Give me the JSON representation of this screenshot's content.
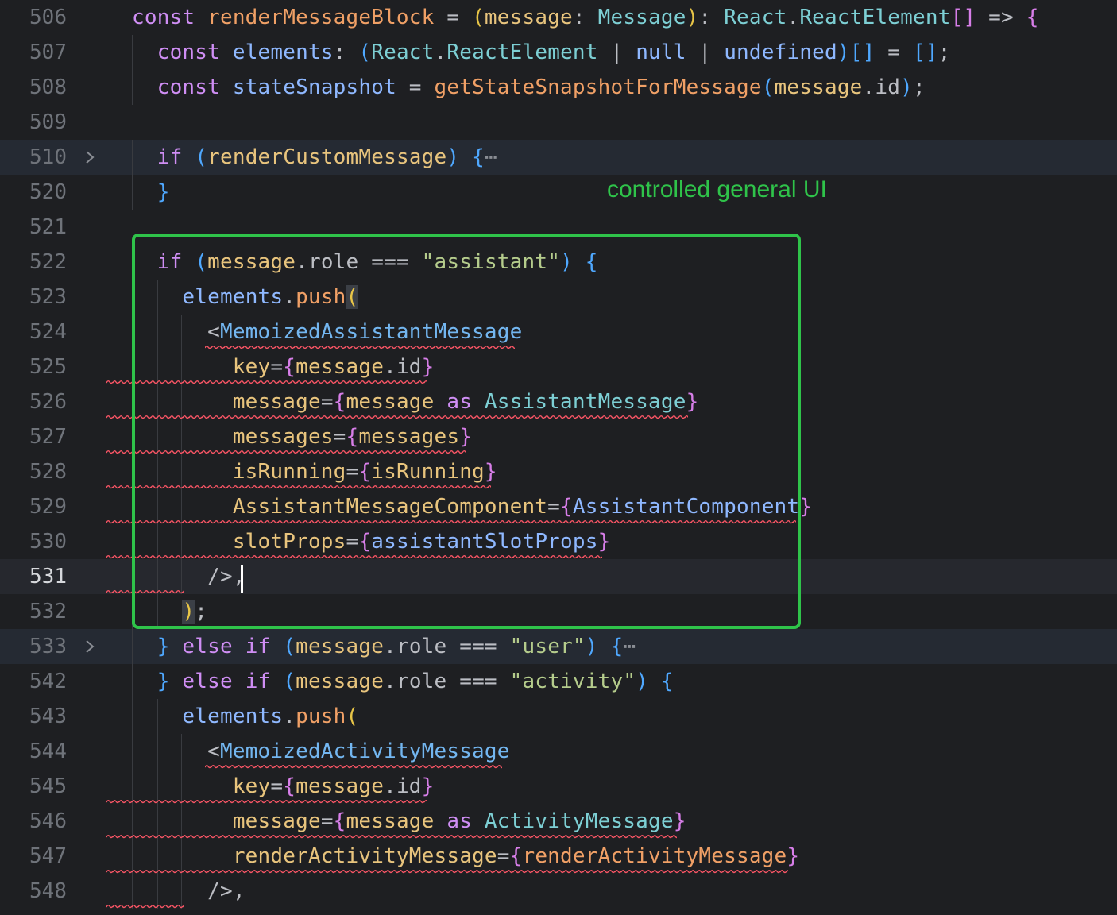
{
  "editor": {
    "annotation": "controlled general UI",
    "lines": [
      {
        "n": "506",
        "segments": [
          [
            "kw",
            "const "
          ],
          [
            "fn",
            "renderMessageBlock"
          ],
          [
            "op",
            " = "
          ],
          [
            "b1",
            "("
          ],
          [
            "pr",
            "message"
          ],
          [
            "op",
            ": "
          ],
          [
            "ty",
            "Message"
          ],
          [
            "b1",
            ")"
          ],
          [
            "op",
            ": "
          ],
          [
            "ty",
            "React"
          ],
          [
            "op",
            "."
          ],
          [
            "ty",
            "ReactElement"
          ],
          [
            "b2",
            "[]"
          ],
          [
            "op",
            " => "
          ],
          [
            "b2",
            "{"
          ]
        ]
      },
      {
        "n": "507",
        "segments": [
          [
            "op",
            "  "
          ],
          [
            "kw",
            "const "
          ],
          [
            "id",
            "elements"
          ],
          [
            "op",
            ": "
          ],
          [
            "b3",
            "("
          ],
          [
            "ty",
            "React"
          ],
          [
            "op",
            "."
          ],
          [
            "ty",
            "ReactElement"
          ],
          [
            "op",
            " | "
          ],
          [
            "id",
            "null"
          ],
          [
            "op",
            " | "
          ],
          [
            "id",
            "undefined"
          ],
          [
            "b3",
            ")[]"
          ],
          [
            "op",
            " = "
          ],
          [
            "b3",
            "[]"
          ],
          [
            "op",
            ";"
          ]
        ]
      },
      {
        "n": "508",
        "segments": [
          [
            "op",
            "  "
          ],
          [
            "kw",
            "const "
          ],
          [
            "id",
            "stateSnapshot"
          ],
          [
            "op",
            " = "
          ],
          [
            "fn",
            "getStateSnapshotForMessage"
          ],
          [
            "b3",
            "("
          ],
          [
            "pr",
            "message"
          ],
          [
            "op",
            "."
          ],
          [
            "op",
            "id"
          ],
          [
            "b3",
            ")"
          ],
          [
            "op",
            ";"
          ]
        ]
      },
      {
        "n": "509",
        "segments": []
      },
      {
        "n": "510",
        "segments": [
          [
            "op",
            "  "
          ],
          [
            "kw",
            "if "
          ],
          [
            "b3",
            "("
          ],
          [
            "pr",
            "renderCustomMessage"
          ],
          [
            "b3",
            ")"
          ],
          [
            "op",
            " "
          ],
          [
            "b3",
            "{"
          ],
          [
            "fold-dots",
            "⋯"
          ]
        ]
      },
      {
        "n": "520",
        "segments": [
          [
            "op",
            "  "
          ],
          [
            "b3",
            "}"
          ]
        ]
      },
      {
        "n": "521",
        "segments": []
      },
      {
        "n": "522",
        "segments": [
          [
            "op",
            "  "
          ],
          [
            "kw",
            "if "
          ],
          [
            "b3",
            "("
          ],
          [
            "pr",
            "message"
          ],
          [
            "op",
            ".role === "
          ],
          [
            "str",
            "\"assistant\""
          ],
          [
            "b3",
            ")"
          ],
          [
            "op",
            " "
          ],
          [
            "b3",
            "{"
          ]
        ]
      },
      {
        "n": "523",
        "segments": [
          [
            "op",
            "    "
          ],
          [
            "id",
            "elements"
          ],
          [
            "op",
            "."
          ],
          [
            "fn",
            "push"
          ],
          [
            "b1",
            "("
          ]
        ]
      },
      {
        "n": "524",
        "segments": [
          [
            "op",
            "      <"
          ],
          [
            "tag",
            "MemoizedAssistantMessage"
          ]
        ]
      },
      {
        "n": "525",
        "segments": [
          [
            "op",
            "        "
          ],
          [
            "jsx",
            "key"
          ],
          [
            "op",
            "="
          ],
          [
            "b2",
            "{"
          ],
          [
            "pr",
            "message"
          ],
          [
            "op",
            "."
          ],
          [
            "op",
            "id"
          ],
          [
            "b2",
            "}"
          ]
        ]
      },
      {
        "n": "526",
        "segments": [
          [
            "op",
            "        "
          ],
          [
            "jsx",
            "message"
          ],
          [
            "op",
            "="
          ],
          [
            "b2",
            "{"
          ],
          [
            "pr",
            "message "
          ],
          [
            "kw",
            "as "
          ],
          [
            "ty",
            "AssistantMessage"
          ],
          [
            "b2",
            "}"
          ]
        ]
      },
      {
        "n": "527",
        "segments": [
          [
            "op",
            "        "
          ],
          [
            "jsx",
            "messages"
          ],
          [
            "op",
            "="
          ],
          [
            "b2",
            "{"
          ],
          [
            "pr",
            "messages"
          ],
          [
            "b2",
            "}"
          ]
        ]
      },
      {
        "n": "528",
        "segments": [
          [
            "op",
            "        "
          ],
          [
            "jsx",
            "isRunning"
          ],
          [
            "op",
            "="
          ],
          [
            "b2",
            "{"
          ],
          [
            "pr",
            "isRunning"
          ],
          [
            "b2",
            "}"
          ]
        ]
      },
      {
        "n": "529",
        "segments": [
          [
            "op",
            "        "
          ],
          [
            "jsx",
            "AssistantMessageComponent"
          ],
          [
            "op",
            "="
          ],
          [
            "b2",
            "{"
          ],
          [
            "id",
            "AssistantComponent"
          ],
          [
            "b2",
            "}"
          ]
        ]
      },
      {
        "n": "530",
        "segments": [
          [
            "op",
            "        "
          ],
          [
            "jsx",
            "slotProps"
          ],
          [
            "op",
            "="
          ],
          [
            "b2",
            "{"
          ],
          [
            "id",
            "assistantSlotProps"
          ],
          [
            "b2",
            "}"
          ]
        ]
      },
      {
        "n": "531",
        "segments": [
          [
            "op",
            "      />,"
          ]
        ]
      },
      {
        "n": "532",
        "segments": [
          [
            "op",
            "    "
          ],
          [
            "b1",
            ")"
          ],
          [
            "op",
            ";"
          ]
        ]
      },
      {
        "n": "533",
        "segments": [
          [
            "op",
            "  "
          ],
          [
            "b3",
            "}"
          ],
          [
            "kw",
            " else if "
          ],
          [
            "b3",
            "("
          ],
          [
            "pr",
            "message"
          ],
          [
            "op",
            ".role === "
          ],
          [
            "str",
            "\"user\""
          ],
          [
            "b3",
            ")"
          ],
          [
            "op",
            " "
          ],
          [
            "b3",
            "{"
          ],
          [
            "fold-dots",
            "⋯"
          ]
        ]
      },
      {
        "n": "542",
        "segments": [
          [
            "op",
            "  "
          ],
          [
            "b3",
            "}"
          ],
          [
            "kw",
            " else if "
          ],
          [
            "b3",
            "("
          ],
          [
            "pr",
            "message"
          ],
          [
            "op",
            ".role === "
          ],
          [
            "str",
            "\"activity\""
          ],
          [
            "b3",
            ")"
          ],
          [
            "op",
            " "
          ],
          [
            "b3",
            "{"
          ]
        ]
      },
      {
        "n": "543",
        "segments": [
          [
            "op",
            "    "
          ],
          [
            "id",
            "elements"
          ],
          [
            "op",
            "."
          ],
          [
            "fn",
            "push"
          ],
          [
            "b1",
            "("
          ]
        ]
      },
      {
        "n": "544",
        "segments": [
          [
            "op",
            "      <"
          ],
          [
            "tag",
            "MemoizedActivityMessage"
          ]
        ]
      },
      {
        "n": "545",
        "segments": [
          [
            "op",
            "        "
          ],
          [
            "jsx",
            "key"
          ],
          [
            "op",
            "="
          ],
          [
            "b2",
            "{"
          ],
          [
            "pr",
            "message"
          ],
          [
            "op",
            "."
          ],
          [
            "op",
            "id"
          ],
          [
            "b2",
            "}"
          ]
        ]
      },
      {
        "n": "546",
        "segments": [
          [
            "op",
            "        "
          ],
          [
            "jsx",
            "message"
          ],
          [
            "op",
            "="
          ],
          [
            "b2",
            "{"
          ],
          [
            "pr",
            "message "
          ],
          [
            "kw",
            "as "
          ],
          [
            "ty",
            "ActivityMessage"
          ],
          [
            "b2",
            "}"
          ]
        ]
      },
      {
        "n": "547",
        "segments": [
          [
            "op",
            "        "
          ],
          [
            "jsx",
            "renderActivityMessage"
          ],
          [
            "op",
            "="
          ],
          [
            "b2",
            "{"
          ],
          [
            "fn",
            "renderActivityMessage"
          ],
          [
            "b2",
            "}"
          ]
        ]
      },
      {
        "n": "548",
        "segments": [
          [
            "op",
            "      />,"
          ]
        ]
      }
    ]
  }
}
